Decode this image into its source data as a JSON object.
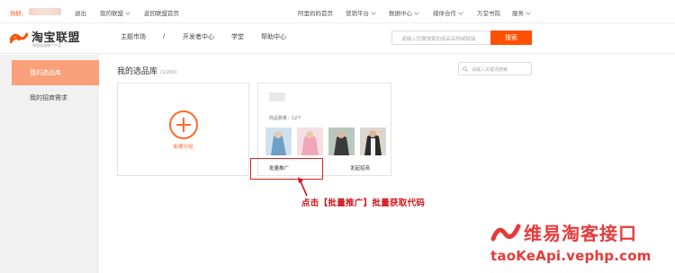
{
  "topbar": {
    "hello": "你好,",
    "logout": "退出",
    "my_alliance": "我的联盟",
    "back_home": "返回联盟首页",
    "ali_mama_home": "阿里妈妈首页",
    "marketing_platform": "营销平台",
    "data_center": "数据中心",
    "media_coop": "媒体合作",
    "wanjia_academy": "万堂书院",
    "service": "服务"
  },
  "header": {
    "logo_text": "淘宝联盟",
    "logo_sub": "帮您连接每个产品",
    "nav": [
      "主题市场",
      "/",
      "开发者中心",
      "学堂",
      "帮助中心"
    ],
    "search_placeholder": "请输入您要搜索的商品名称或链接",
    "search_button": "搜索"
  },
  "sidebar": {
    "items": [
      {
        "label": "我的选品库",
        "active": true
      },
      {
        "label": "我的招商需求",
        "active": false
      }
    ]
  },
  "main": {
    "title": "我的选品库",
    "count": "(1/200)",
    "filter_placeholder": "请输入关键词搜索",
    "new_group_label": "新建分组",
    "group": {
      "count_label": "商品数量：12个",
      "batch_promote": "批量推广",
      "publish_invite": "发起招商"
    }
  },
  "annotation": {
    "text": "点击【批量推广】批量获取代码",
    "color": "#d0151b"
  },
  "watermark": {
    "title": "维易淘客接口",
    "url": "taoKeApi.vephp.com",
    "color": "#e83a3a"
  },
  "colors": {
    "accent": "#ff5000",
    "sidebar_active": "#f7a07a"
  }
}
